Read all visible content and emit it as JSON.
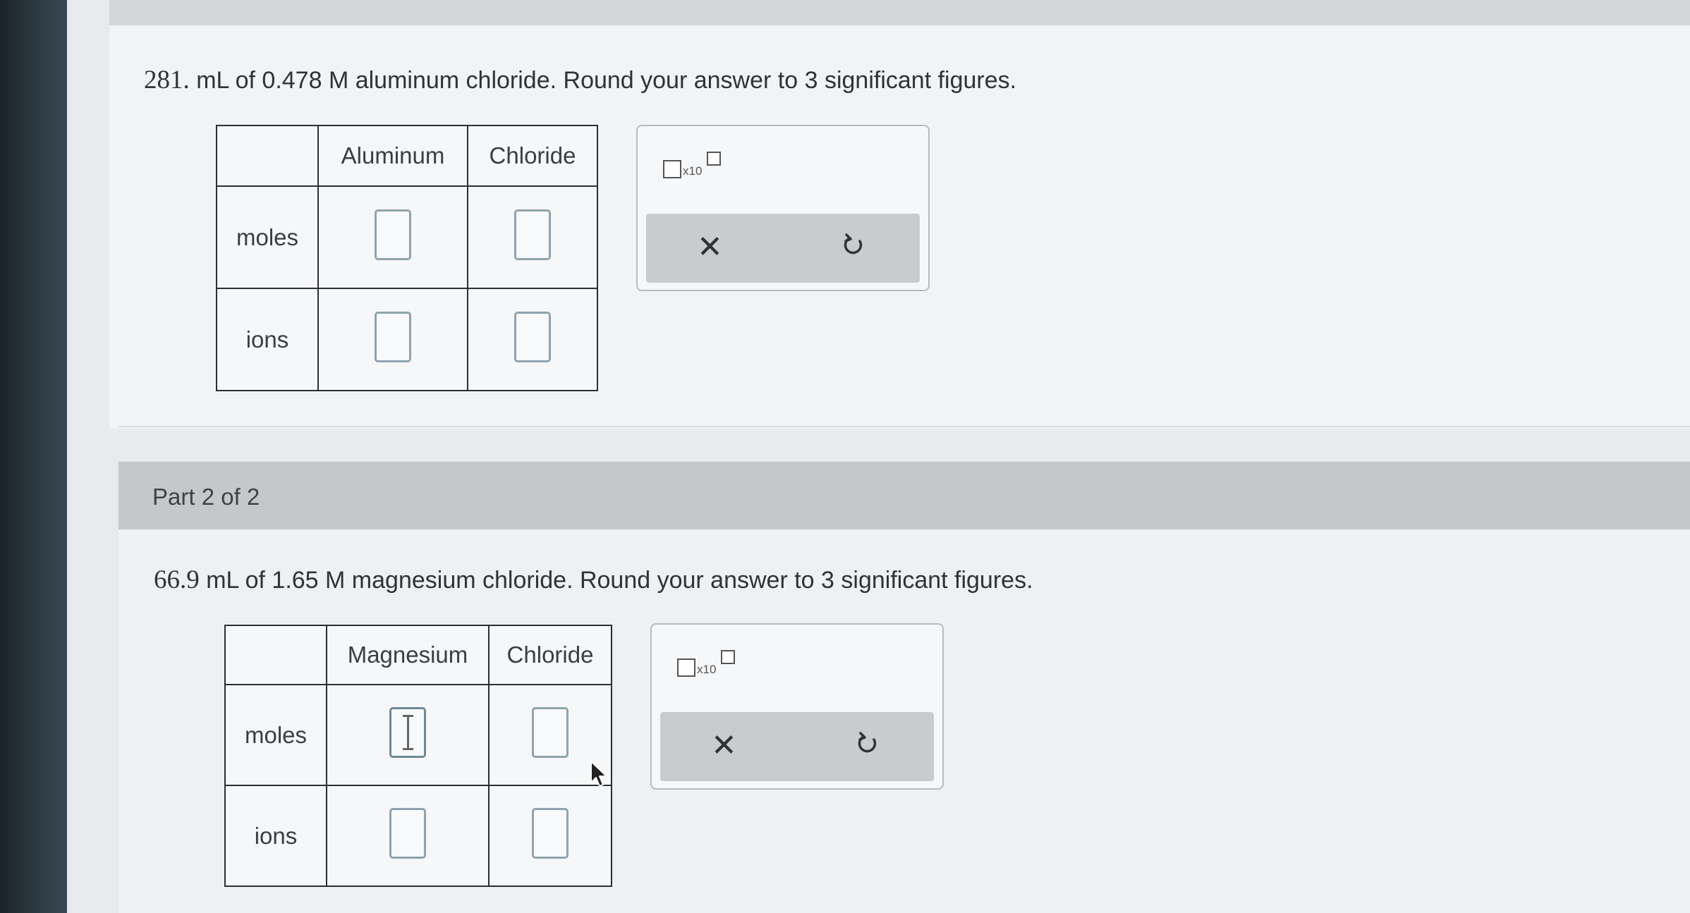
{
  "part1": {
    "question_num": "281.",
    "question_text": "mL of 0.478 M aluminum chloride. Round your answer to 3 significant figures.",
    "table": {
      "col1": "Aluminum",
      "col2": "Chloride",
      "row1": "moles",
      "row2": "ions"
    },
    "sci_multiplier": "x10"
  },
  "part2": {
    "header": "Part 2 of 2",
    "question_num": "66.9",
    "question_text": "mL of 1.65 M magnesium chloride. Round your answer to 3 significant figures.",
    "table": {
      "col1": "Magnesium",
      "col2": "Chloride",
      "row1": "moles",
      "row2": "ions"
    },
    "sci_multiplier": "x10"
  },
  "icons": {
    "clear": "close-icon",
    "reset": "undo-icon",
    "scientific": "scientific-notation-icon",
    "mouse": "mouse-pointer-icon"
  },
  "colors": {
    "action_bar": "#c9ccce",
    "part_header": "#c5c7c9",
    "input_border": "#8fa3ae"
  }
}
